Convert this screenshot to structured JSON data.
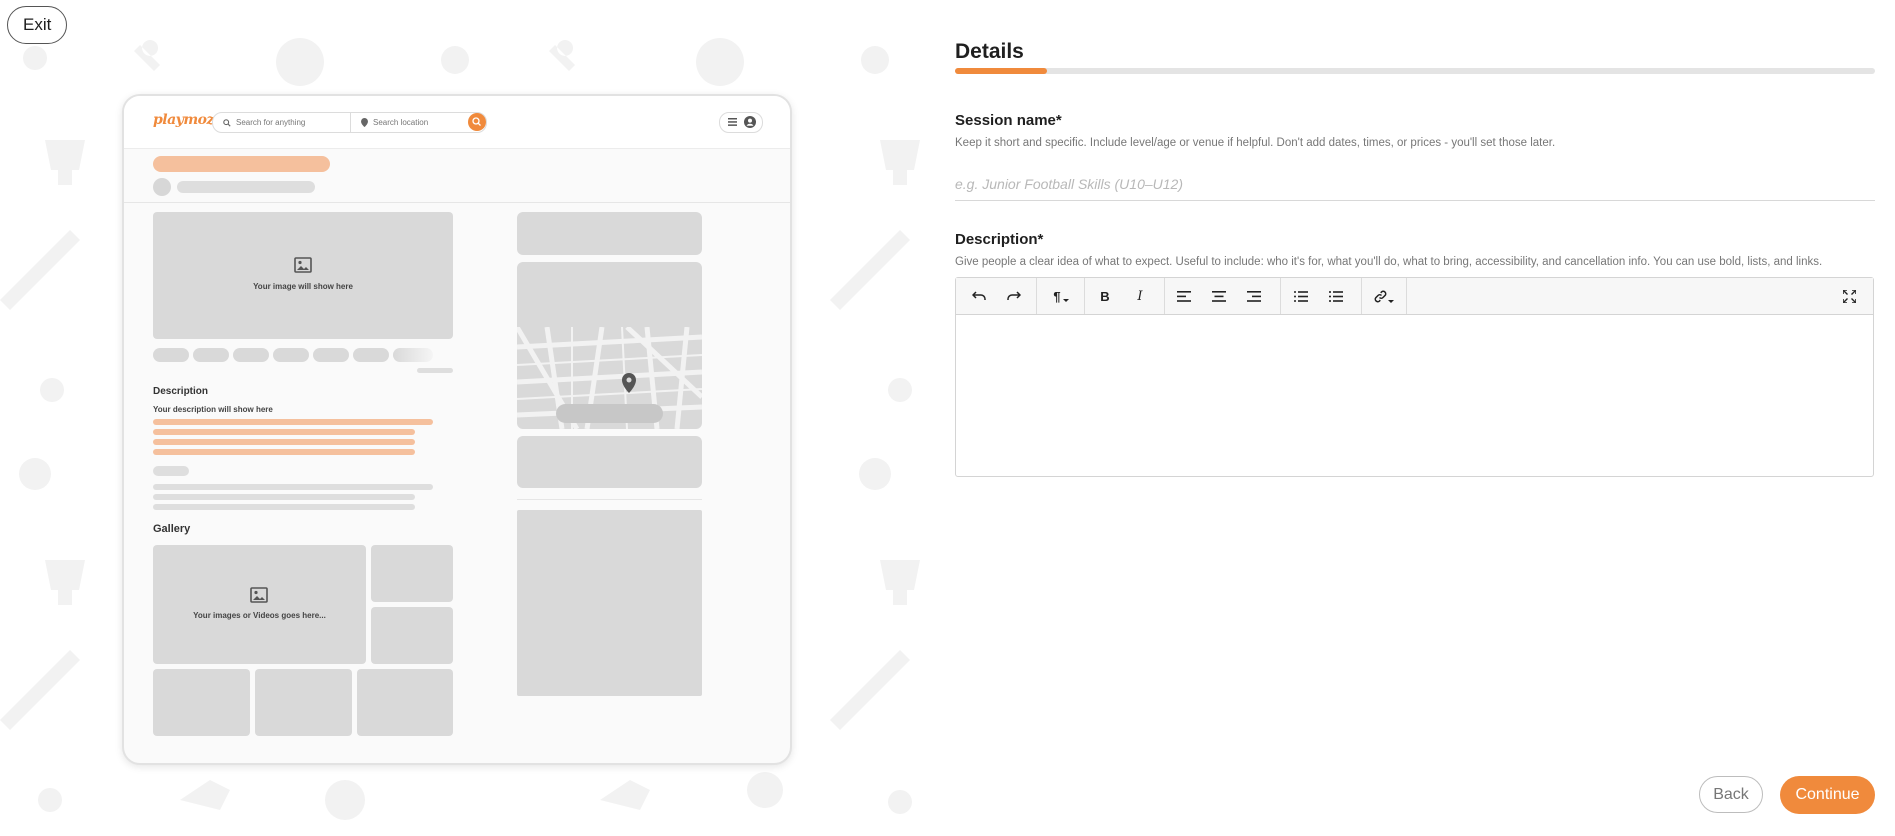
{
  "top": {
    "exit_label": "Exit"
  },
  "preview": {
    "logo": "playmoze",
    "search_placeholder": "Search for anything",
    "location_placeholder": "Search location",
    "image_caption": "Your image will show here",
    "description_heading": "Description",
    "description_caption": "Your description will show here",
    "gallery_heading": "Gallery",
    "gallery_caption": "Your images or Videos goes here..."
  },
  "form": {
    "title": "Details",
    "progress_fraction": 0.1,
    "session_name": {
      "label": "Session name*",
      "help": "Keep it short and specific. Include level/age or venue if helpful. Don't add dates, times, or prices - you'll set those later.",
      "placeholder": "e.g. Junior Football Skills (U10–U12)",
      "value": ""
    },
    "description": {
      "label": "Description*",
      "help": "Give people a clear idea of what to expect. Useful to include: who it's for, what you'll do, what to bring, accessibility, and cancellation info. You can use bold, lists, and links.",
      "toolbar": {
        "undo_icon": "undo-icon",
        "redo_icon": "redo-icon",
        "paragraph_glyph": "¶",
        "bold_glyph": "B",
        "italic_glyph": "I",
        "align_left_icon": "align-left-icon",
        "align_center_icon": "align-center-icon",
        "align_right_icon": "align-right-icon",
        "bullet_list_icon": "bullet-list-icon",
        "numbered_list_icon": "numbered-list-icon",
        "link_icon": "link-icon",
        "fullscreen_icon": "fullscreen-icon"
      }
    }
  },
  "footer": {
    "back_label": "Back",
    "continue_label": "Continue"
  },
  "colors": {
    "accent": "#f08a3c",
    "accent_light": "#f5c09d",
    "placeholder_grey": "#d9d9d9"
  }
}
